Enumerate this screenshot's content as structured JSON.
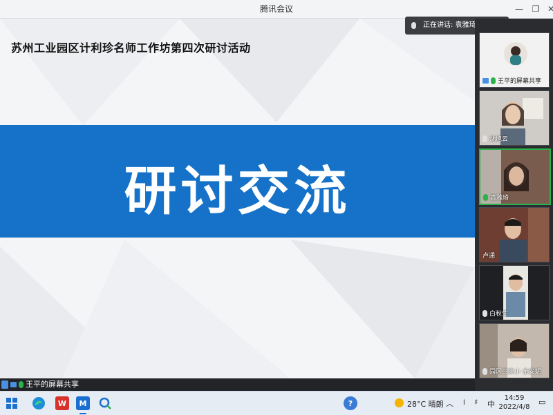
{
  "window": {
    "title": "腾讯会议"
  },
  "speaking": {
    "text": "正在讲话: 袁雅琦; 王平"
  },
  "slide": {
    "heading": "苏州工业园区计利珍名师工作坊第四次研讨活动",
    "banner_text": "研讨交流",
    "banner_color": "#1572c8"
  },
  "participants": [
    {
      "name": "王平的屏幕共享",
      "mic": "on",
      "speaking": false
    },
    {
      "name": "沈旭云",
      "mic": "off",
      "speaking": false
    },
    {
      "name": "袁雅琦",
      "mic": "on",
      "speaking": true
    },
    {
      "name": "卢通",
      "mic": "off",
      "speaking": false
    },
    {
      "name": "白秋生",
      "mic": "off",
      "speaking": false
    },
    {
      "name": "园区三实小 余安妮",
      "mic": "off",
      "speaking": false
    }
  ],
  "share_label": "王平的屏幕共享",
  "taskbar": {
    "apps": [
      "start-icon",
      "edge-icon",
      "wps-icon",
      "tencent-meeting-icon",
      "search-app-icon"
    ],
    "weather": "28°C 晴朗",
    "ime": "中",
    "time": "14:59",
    "date": "2022/4/8"
  },
  "colors": {
    "speaking_border": "#2bb24c",
    "accent": "#1572c8"
  }
}
